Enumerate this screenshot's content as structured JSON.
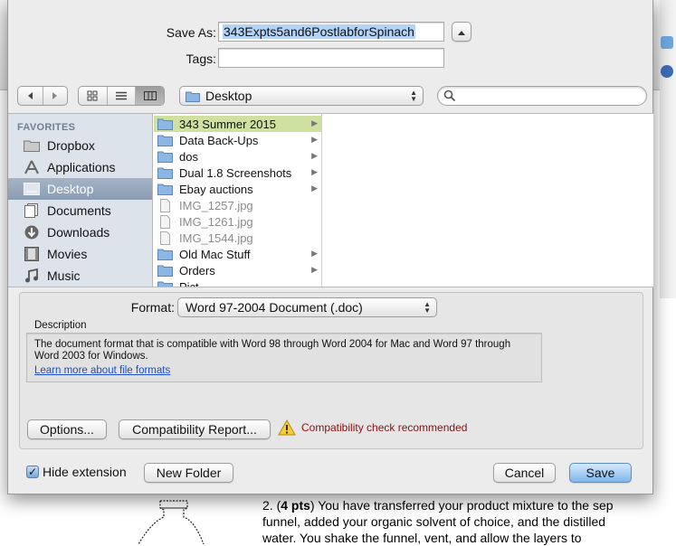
{
  "dialog": {
    "save_as_label": "Save As:",
    "save_as_value": "343Expts5and6PostlabforSpinach",
    "tags_label": "Tags:",
    "tags_value": "",
    "location": "Desktop",
    "search_placeholder": ""
  },
  "sidebar": {
    "header": "FAVORITES",
    "items": [
      {
        "label": "Dropbox",
        "icon": "folder-icon",
        "selected": false
      },
      {
        "label": "Applications",
        "icon": "applications-icon",
        "selected": false
      },
      {
        "label": "Desktop",
        "icon": "desktop-icon",
        "selected": true
      },
      {
        "label": "Documents",
        "icon": "documents-icon",
        "selected": false
      },
      {
        "label": "Downloads",
        "icon": "downloads-icon",
        "selected": false
      },
      {
        "label": "Movies",
        "icon": "movies-icon",
        "selected": false
      },
      {
        "label": "Music",
        "icon": "music-icon",
        "selected": false
      }
    ]
  },
  "files": [
    {
      "name": "343 Summer 2015",
      "type": "folder",
      "selected": true
    },
    {
      "name": "Data Back-Ups",
      "type": "folder"
    },
    {
      "name": "dos",
      "type": "folder"
    },
    {
      "name": "Dual 1.8 Screenshots",
      "type": "folder"
    },
    {
      "name": "Ebay auctions",
      "type": "folder"
    },
    {
      "name": "IMG_1257.jpg",
      "type": "file"
    },
    {
      "name": "IMG_1261.jpg",
      "type": "file"
    },
    {
      "name": "IMG_1544.jpg",
      "type": "file"
    },
    {
      "name": "Old Mac Stuff",
      "type": "folder"
    },
    {
      "name": "Orders",
      "type": "folder"
    },
    {
      "name": "Pict",
      "type": "folder"
    }
  ],
  "format": {
    "label": "Format:",
    "value": "Word 97-2004 Document (.doc)",
    "description_label": "Description",
    "description_text": "The document format that is compatible with Word 98 through Word 2004 for Mac and Word 97 through Word 2003 for Windows.",
    "learn_more": "Learn more about file formats"
  },
  "buttons": {
    "options": "Options...",
    "compat": "Compatibility Report...",
    "warning": "Compatibility check recommended",
    "hide_ext": "Hide extension",
    "hide_ext_checked": true,
    "new_folder": "New Folder",
    "cancel": "Cancel",
    "save": "Save"
  },
  "background_doc": {
    "q_num": "2. (",
    "q_pts": "4 pts",
    "line1_rest": ") You have transferred your product mixture to the sep",
    "line2": "funnel, added your organic solvent of choice, and the distilled",
    "line3": "water.  You shake the funnel, vent, and allow the layers to"
  },
  "colors": {
    "accent": "#7fb6ee",
    "selection_folder": "#cfe1a0",
    "sidebar_bg": "#dde3ea",
    "warning_text": "#8a0e0e"
  }
}
